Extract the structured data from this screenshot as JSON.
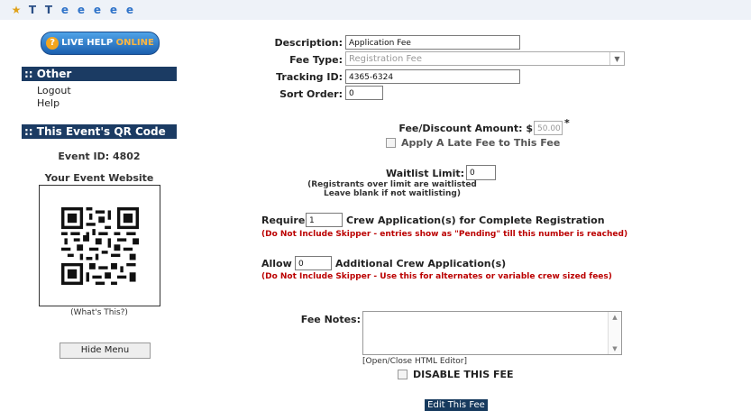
{
  "toolbar": {
    "icons": [
      "favorites-star-icon",
      "t-icon",
      "t-icon",
      "ie-icon",
      "ie-icon",
      "ie-icon",
      "ie-icon",
      "ie-icon"
    ]
  },
  "sidebar": {
    "live_help": {
      "prefix": "LIVE HELP",
      "suffix": "ONLINE"
    },
    "other_header": ":: Other",
    "links": [
      "Logout",
      "Help"
    ],
    "qr_header": ":: This Event's QR Code",
    "event_id": "Event ID: 4802",
    "website_label": "Your Event Website",
    "whats_this": "(What's This?)",
    "hide_menu": "Hide Menu"
  },
  "form": {
    "description": {
      "label": "Description:",
      "value": "Application Fee"
    },
    "fee_type": {
      "label": "Fee Type:",
      "value": "Registration Fee"
    },
    "tracking_id": {
      "label": "Tracking ID:",
      "value": "4365-6324"
    },
    "sort_order": {
      "label": "Sort Order:",
      "value": "0"
    },
    "amount": {
      "label": "Fee/Discount Amount: $",
      "value": "50.00",
      "required": "*"
    },
    "late_fee": {
      "label": "Apply A Late Fee to This Fee"
    },
    "waitlist": {
      "label": "Waitlist Limit:",
      "value": "0",
      "note_line1": "(Registrants over limit are waitlisted -",
      "note_line2": "Leave blank if not waitlisting)"
    },
    "require_crew": {
      "prefix": "Require",
      "value": "1",
      "suffix": "Crew Application(s) for Complete Registration",
      "note": "(Do Not Include Skipper - entries show as \"Pending\" till this number is reached)"
    },
    "allow_crew": {
      "prefix": "Allow",
      "value": "0",
      "suffix": "Additional Crew Application(s)",
      "note": "(Do Not Include Skipper - Use this for alternates or variable crew sized fees)"
    },
    "fee_notes": {
      "label": "Fee Notes:",
      "html_editor": "[Open/Close HTML Editor]"
    },
    "disable": {
      "label": "DISABLE THIS FEE"
    },
    "submit": "Edit This Fee"
  }
}
